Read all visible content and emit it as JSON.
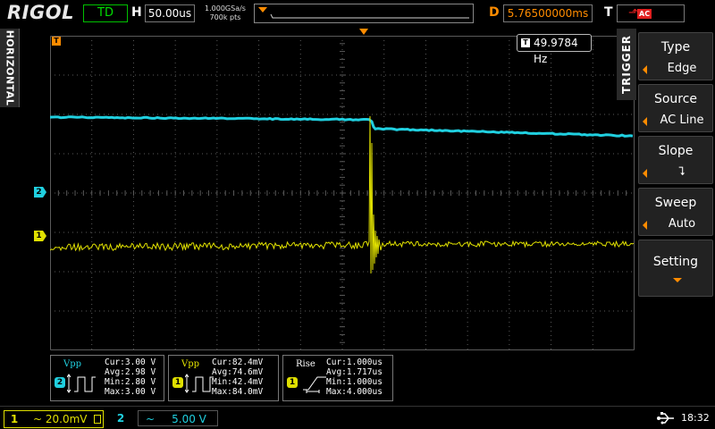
{
  "topbar": {
    "logo": "RIGOL",
    "run_status": "TD",
    "timebase_letter": "H",
    "timebase": "50.00us",
    "sample_rate": "1.000GSa/s",
    "memory_depth": "700k pts",
    "delay_letter": "D",
    "delay": "5.76500000ms",
    "trigger_letter": "T",
    "trigger_source_badge": "AC",
    "trigger_edge_glyph": "⬏"
  },
  "horizontal_label": "HORIZONTAL",
  "trigger_label": "TRIGGER",
  "markers": {
    "trigger_T": "T",
    "ch1": "1",
    "ch2": "2"
  },
  "frequency": "49.9784 Hz",
  "menu": {
    "items": [
      {
        "title": "Type",
        "value": "Edge"
      },
      {
        "title": "Source",
        "value": "AC Line"
      },
      {
        "title": "Slope",
        "value": "⮧"
      },
      {
        "title": "Sweep",
        "value": "Auto"
      },
      {
        "title": "Setting",
        "value": ""
      }
    ]
  },
  "measurements": [
    {
      "name": "Vpp",
      "channel": "2",
      "cur": "Cur:3.00 V",
      "avg": "Avg:2.98 V",
      "min": "Min:2.80 V",
      "max": "Max:3.00 V"
    },
    {
      "name": "Vpp",
      "channel": "1",
      "cur": "Cur:82.4mV",
      "avg": "Avg:74.6mV",
      "min": "Min:42.4mV",
      "max": "Max:84.0mV"
    },
    {
      "name": "Rise",
      "channel": "1",
      "cur": "Cur:1.000us",
      "avg": "Avg:1.717us",
      "min": "Min:1.000us",
      "max": "Max:4.000us"
    }
  ],
  "channels": {
    "ch1": {
      "num": "1",
      "info": "~ 20.0mV"
    },
    "ch2": {
      "num": "2",
      "info": "~     5.00 V"
    }
  },
  "clock": "18:32",
  "colors": {
    "ch1": "#e0e000",
    "ch2": "#20d0e0",
    "accent": "#ff8c00",
    "grid": "#5a5a5a"
  }
}
